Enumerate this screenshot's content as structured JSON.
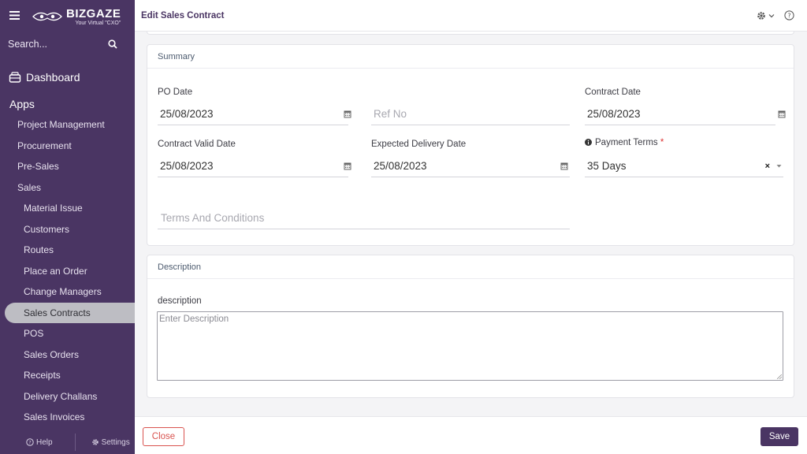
{
  "sidebar": {
    "logo": {
      "main": "BIZGAZE",
      "tagline": "Your Virtual \"CXO\""
    },
    "search_placeholder": "Search...",
    "dashboard_label": "Dashboard",
    "apps_label": "Apps",
    "items": [
      {
        "label": "Project Management",
        "level": 1
      },
      {
        "label": "Procurement",
        "level": 1
      },
      {
        "label": "Pre-Sales",
        "level": 1
      },
      {
        "label": "Sales",
        "level": 1
      },
      {
        "label": "Material Issue",
        "level": 2
      },
      {
        "label": "Customers",
        "level": 2
      },
      {
        "label": "Routes",
        "level": 2
      },
      {
        "label": "Place an Order",
        "level": 2
      },
      {
        "label": "Change Managers",
        "level": 2
      },
      {
        "label": "Sales Contracts",
        "level": 2,
        "active": true
      },
      {
        "label": "POS",
        "level": 2
      },
      {
        "label": "Sales Orders",
        "level": 2
      },
      {
        "label": "Receipts",
        "level": 2
      },
      {
        "label": "Delivery Challans",
        "level": 2
      },
      {
        "label": "Sales Invoices",
        "level": 2
      }
    ],
    "help_label": "Help",
    "settings_label": "Settings"
  },
  "header": {
    "title": "Edit Sales Contract"
  },
  "summary": {
    "title": "Summary",
    "po_date": {
      "label": "PO Date",
      "value": "25/08/2023"
    },
    "ref_no": {
      "placeholder": "Ref No"
    },
    "contract_date": {
      "label": "Contract Date",
      "value": "25/08/2023"
    },
    "contract_valid_date": {
      "label": "Contract Valid Date",
      "value": "25/08/2023"
    },
    "expected_delivery_date": {
      "label": "Expected Delivery Date",
      "value": "25/08/2023"
    },
    "payment_terms": {
      "label": "Payment Terms",
      "required": "*",
      "value": "35 Days",
      "clear": "×"
    },
    "terms_and_conditions": {
      "placeholder": "Terms And Conditions"
    }
  },
  "description_section": {
    "title": "Description",
    "label": "description",
    "placeholder": "Enter Description"
  },
  "footer": {
    "close_label": "Close",
    "save_label": "Save"
  },
  "colors": {
    "brand": "#4a3563",
    "danger": "#d9534f",
    "active_item_bg": "#bdbdc3"
  }
}
